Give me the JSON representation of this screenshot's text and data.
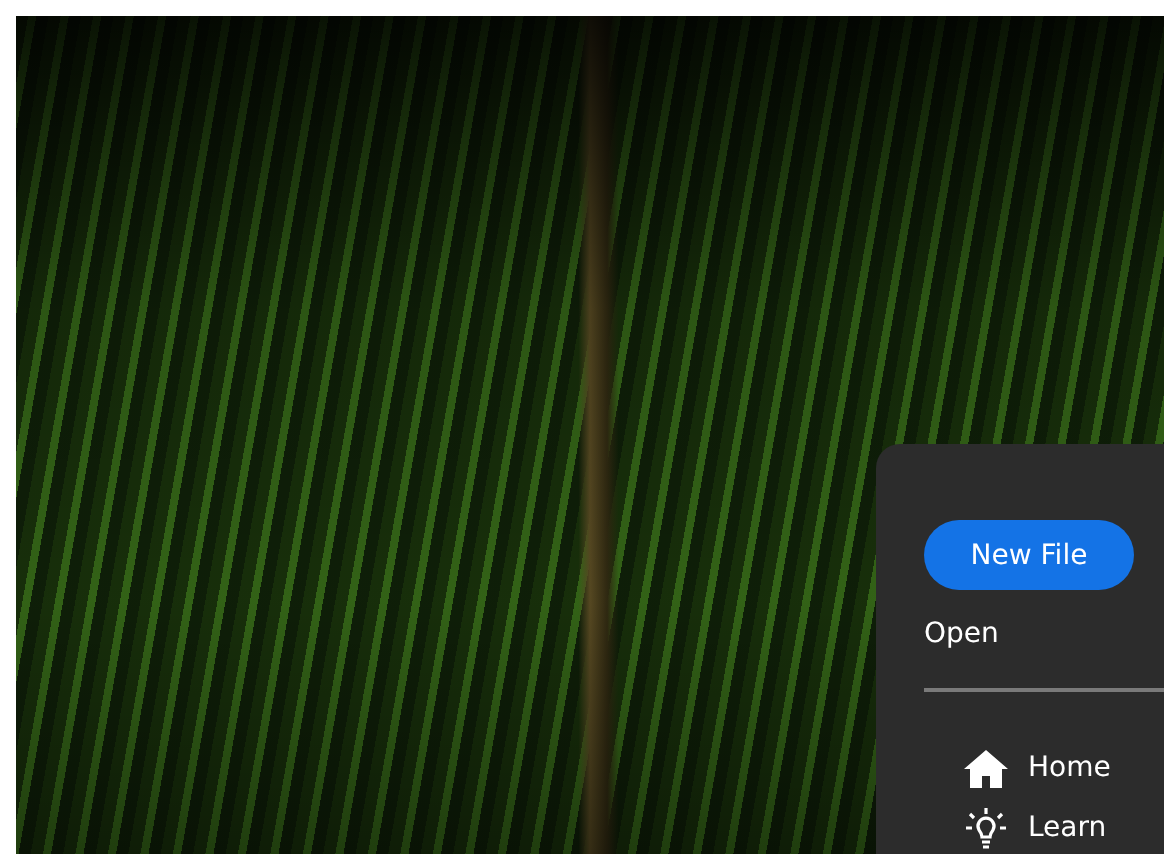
{
  "start_panel": {
    "primary_button": "New File",
    "actions": [
      {
        "label": "Open"
      }
    ],
    "nav_items": [
      {
        "kind": "home",
        "label": "Home"
      },
      {
        "kind": "learn",
        "label": "Learn"
      }
    ]
  }
}
